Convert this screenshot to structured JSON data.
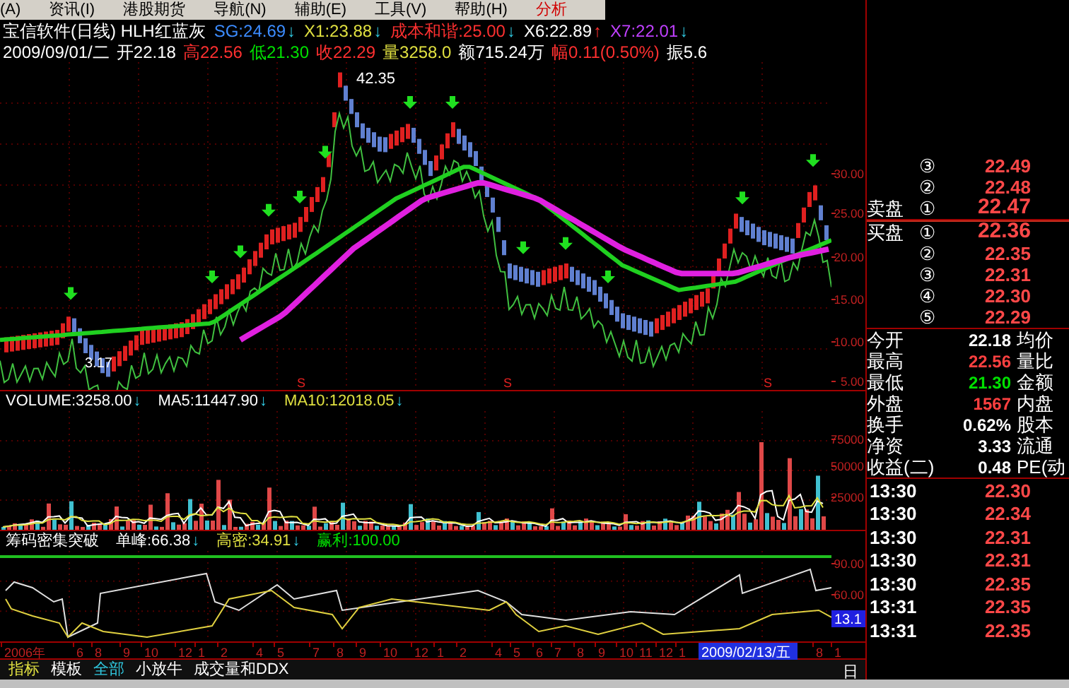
{
  "menu": [
    {
      "label": "(A)",
      "kind": "normal"
    },
    {
      "label": "资讯(I)",
      "kind": "normal"
    },
    {
      "label": "港股期货",
      "kind": "normal"
    },
    {
      "label": "导航(N)",
      "kind": "normal"
    },
    {
      "label": "辅助(E)",
      "kind": "normal"
    },
    {
      "label": "工具(V)",
      "kind": "normal"
    },
    {
      "label": "帮助(H)",
      "kind": "normal"
    },
    {
      "label": "分析",
      "kind": "accent"
    }
  ],
  "header": {
    "title": "宝信软件(日线) HLH红蓝灰",
    "indicators": [
      {
        "text": "SG:24.69",
        "color": "#3c8cff",
        "arrow": "↓",
        "kind": "down"
      },
      {
        "text": "X1:23.88",
        "color": "#e0e040",
        "arrow": "↓",
        "kind": "down"
      },
      {
        "text": "成本和谐:25.00",
        "color": "#ff3030",
        "arrow": "↓",
        "kind": "down"
      },
      {
        "text": "X6:22.89",
        "color": "#ffffff",
        "arrow": "↑",
        "kind": "up"
      },
      {
        "text": "X7:22.01",
        "color": "#c040ff",
        "arrow": "↓",
        "kind": "down"
      }
    ]
  },
  "quote_line": {
    "date": "2009/09/01/二",
    "fields": [
      {
        "text": "开22.18",
        "color": "#ffffff"
      },
      {
        "text": "高22.56",
        "color": "#ff3030"
      },
      {
        "text": "低21.30",
        "color": "#00e000"
      },
      {
        "text": "收22.29",
        "color": "#ff3030"
      },
      {
        "text": "量3258.0",
        "color": "#e0e040"
      },
      {
        "text": "额715.24万",
        "color": "#ffffff"
      },
      {
        "text": "幅0.11(0.50%)",
        "color": "#ff3030"
      },
      {
        "text": "振5.6",
        "color": "#ffffff"
      }
    ]
  },
  "main_chart": {
    "high_label": "42.35",
    "low_label": "3.17",
    "markers": [
      "S",
      "S",
      "S"
    ],
    "axis_labels": [
      "30.00",
      "25.00",
      "20.00",
      "15.00",
      "10.00",
      "5.00"
    ]
  },
  "volume": {
    "indicators": [
      {
        "text": "VOLUME:3258.00",
        "color": "#ffffff",
        "arrow": "↓",
        "kind": "down"
      },
      {
        "text": "MA5:11447.90",
        "color": "#ffffff",
        "arrow": "↓",
        "kind": "down"
      },
      {
        "text": "MA10:12018.05",
        "color": "#e0e040",
        "arrow": "↓",
        "kind": "down"
      }
    ],
    "axis_labels": [
      "75000",
      "50000",
      "25000"
    ]
  },
  "indicator_panel": {
    "title": "筹码密集突破",
    "indicators": [
      {
        "text": "单峰:66.38",
        "color": "#ffffff",
        "arrow": "↓",
        "kind": "down"
      },
      {
        "text": "高密:34.91",
        "color": "#e0e040",
        "arrow": "↓",
        "kind": "down"
      },
      {
        "text": "赢利:100.00",
        "color": "#00e000"
      }
    ],
    "axis_labels": [
      "90.00",
      "60.00"
    ],
    "cursor_value": "13.1"
  },
  "date_axis": [
    {
      "text": "2006年",
      "kind": "date"
    },
    {
      "text": "6",
      "kind": "date"
    },
    {
      "text": "8",
      "kind": "date"
    },
    {
      "text": "9",
      "kind": "date"
    },
    {
      "text": "10",
      "kind": "date"
    },
    {
      "text": "12",
      "kind": "date"
    },
    {
      "text": "1",
      "kind": "date"
    },
    {
      "text": "2",
      "kind": "date"
    },
    {
      "text": "4",
      "kind": "date"
    },
    {
      "text": "5",
      "kind": "date"
    },
    {
      "text": "7",
      "kind": "date"
    },
    {
      "text": "8",
      "kind": "date"
    },
    {
      "text": "9",
      "kind": "date"
    },
    {
      "text": "10",
      "kind": "date"
    },
    {
      "text": "12",
      "kind": "date"
    },
    {
      "text": "1",
      "kind": "date"
    },
    {
      "text": "2",
      "kind": "date"
    },
    {
      "text": "4",
      "kind": "date"
    },
    {
      "text": "5",
      "kind": "date"
    },
    {
      "text": "6",
      "kind": "date"
    },
    {
      "text": "7",
      "kind": "date"
    },
    {
      "text": "8",
      "kind": "date"
    },
    {
      "text": "9",
      "kind": "date"
    },
    {
      "text": "10",
      "kind": "date"
    },
    {
      "text": "11",
      "kind": "date"
    },
    {
      "text": "12",
      "kind": "date"
    },
    {
      "text": "1",
      "kind": "date"
    },
    {
      "text": "2009/02/13/五",
      "kind": "cursor"
    },
    {
      "text": "8",
      "kind": "date"
    },
    {
      "text": "1",
      "kind": "date"
    }
  ],
  "bottom_bar": {
    "title": "指标",
    "tabs": [
      {
        "label": "模板",
        "selected": false
      },
      {
        "label": "全部",
        "selected": true
      },
      {
        "label": "小放牛",
        "selected": false
      },
      {
        "label": "成交量和DDX",
        "selected": false
      }
    ]
  },
  "period_label": "日",
  "order_book": {
    "asks": [
      {
        "index": "③",
        "price": "22.49"
      },
      {
        "index": "②",
        "price": "22.48"
      },
      {
        "label": "卖盘",
        "index": "①",
        "price": "22.47"
      }
    ],
    "bids": [
      {
        "label": "买盘",
        "index": "①",
        "price": "22.36"
      },
      {
        "index": "②",
        "price": "22.35"
      },
      {
        "index": "③",
        "price": "22.31"
      },
      {
        "index": "④",
        "price": "22.30"
      },
      {
        "index": "⑤",
        "price": "22.29"
      }
    ]
  },
  "stats": [
    {
      "label": "今开",
      "value": "22.18",
      "color": "#ffffff",
      "label2": "均价"
    },
    {
      "label": "最高",
      "value": "22.56",
      "color": "#ff4040",
      "label2": "量比"
    },
    {
      "label": "最低",
      "value": "21.30",
      "color": "#00e000",
      "label2": "金额"
    },
    {
      "label": "外盘",
      "value": "1567",
      "color": "#ff4040",
      "label2": "内盘"
    },
    {
      "label": "换手",
      "value": "0.62%",
      "color": "#ffffff",
      "label2": "股本"
    },
    {
      "label": "净资",
      "value": "3.33",
      "color": "#ffffff",
      "label2": "流通"
    },
    {
      "label": "收益(二)",
      "value": "0.48",
      "color": "#ffffff",
      "label2": "PE(动"
    }
  ],
  "ticks": [
    {
      "time": "13:30",
      "price": "22.30"
    },
    {
      "time": "13:30",
      "price": "22.34"
    },
    {
      "time": "13:30",
      "price": "22.31"
    },
    {
      "time": "13:30",
      "price": "22.31"
    },
    {
      "time": "13:30",
      "price": "22.35"
    },
    {
      "time": "13:31",
      "price": "22.35"
    },
    {
      "time": "13:31",
      "price": "22.35"
    }
  ]
}
